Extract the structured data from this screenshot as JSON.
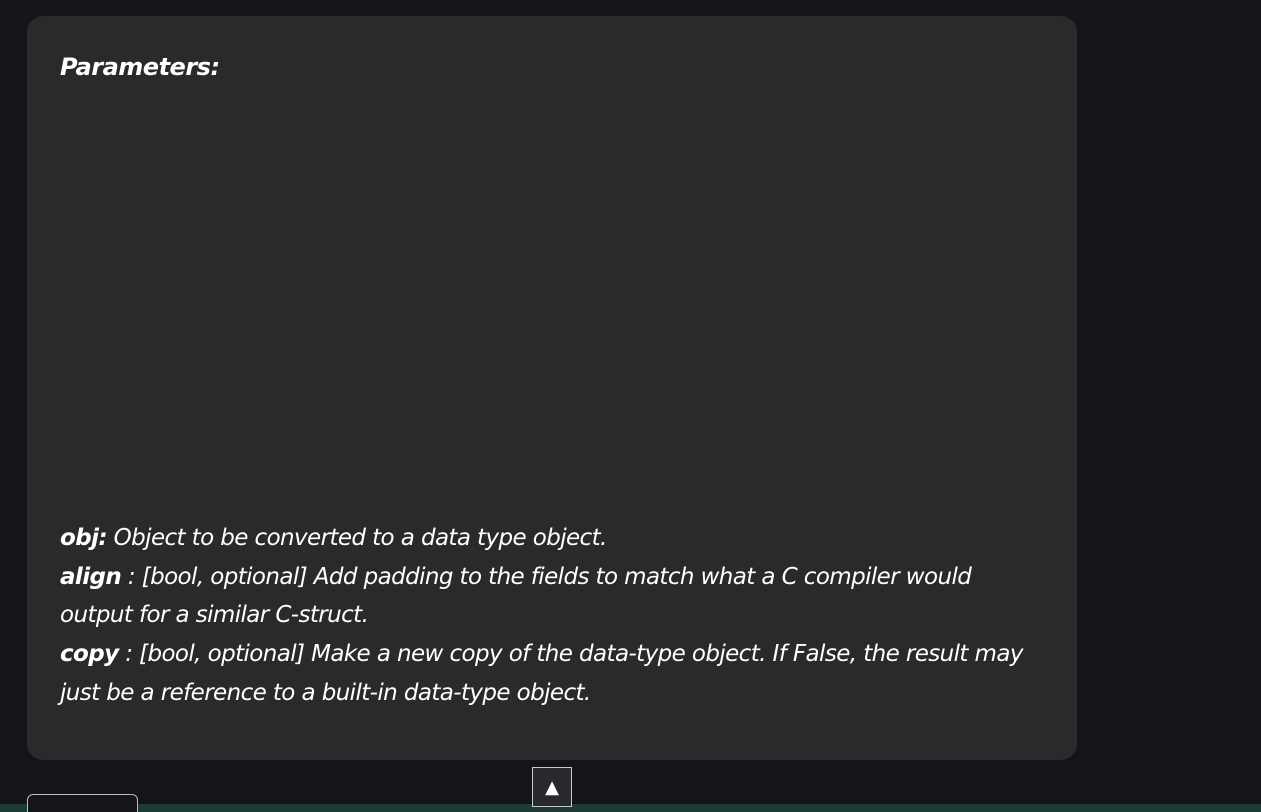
{
  "card": {
    "heading": "Parameters:",
    "params": [
      {
        "name": "obj:",
        "desc": " Object to be converted to a data type object."
      },
      {
        "name": "align",
        "desc": " : [bool, optional] Add padding to the fields to match what a C compiler would output for a similar C-struct."
      },
      {
        "name": "copy",
        "desc": " : [bool, optional] Make a new copy of the data-type object. If False, the result may just be a reference to a built-in data-type object."
      }
    ]
  },
  "scroll_top": {
    "label": "▲"
  },
  "colors": {
    "page_background": "#141518",
    "card_background": "#2a2a2d",
    "text": "#ffffff",
    "footer_strip": "#1d3b35"
  }
}
